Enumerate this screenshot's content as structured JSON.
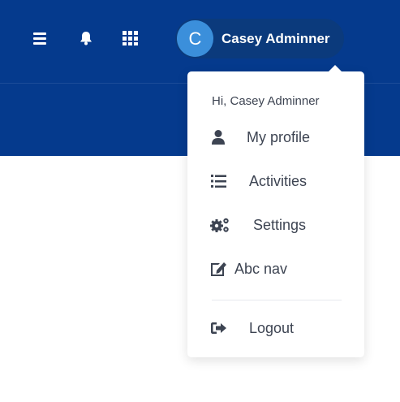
{
  "header": {
    "icons": [
      "menu-icon",
      "bell-icon",
      "grid-icon"
    ],
    "user": {
      "initial": "C",
      "name": "Casey Adminner"
    }
  },
  "dropdown": {
    "greeting": "Hi, Casey Adminner",
    "items": [
      {
        "label": "My profile",
        "icon": "user-icon"
      },
      {
        "label": "Activities",
        "icon": "list-icon"
      },
      {
        "label": "Settings",
        "icon": "gears-icon"
      },
      {
        "label": "Abc nav",
        "icon": "edit-icon"
      }
    ],
    "logout": {
      "label": "Logout",
      "icon": "logout-icon"
    }
  },
  "colors": {
    "header": "#053a8d",
    "avatar": "#3b8fdb",
    "text": "#3d4452"
  }
}
